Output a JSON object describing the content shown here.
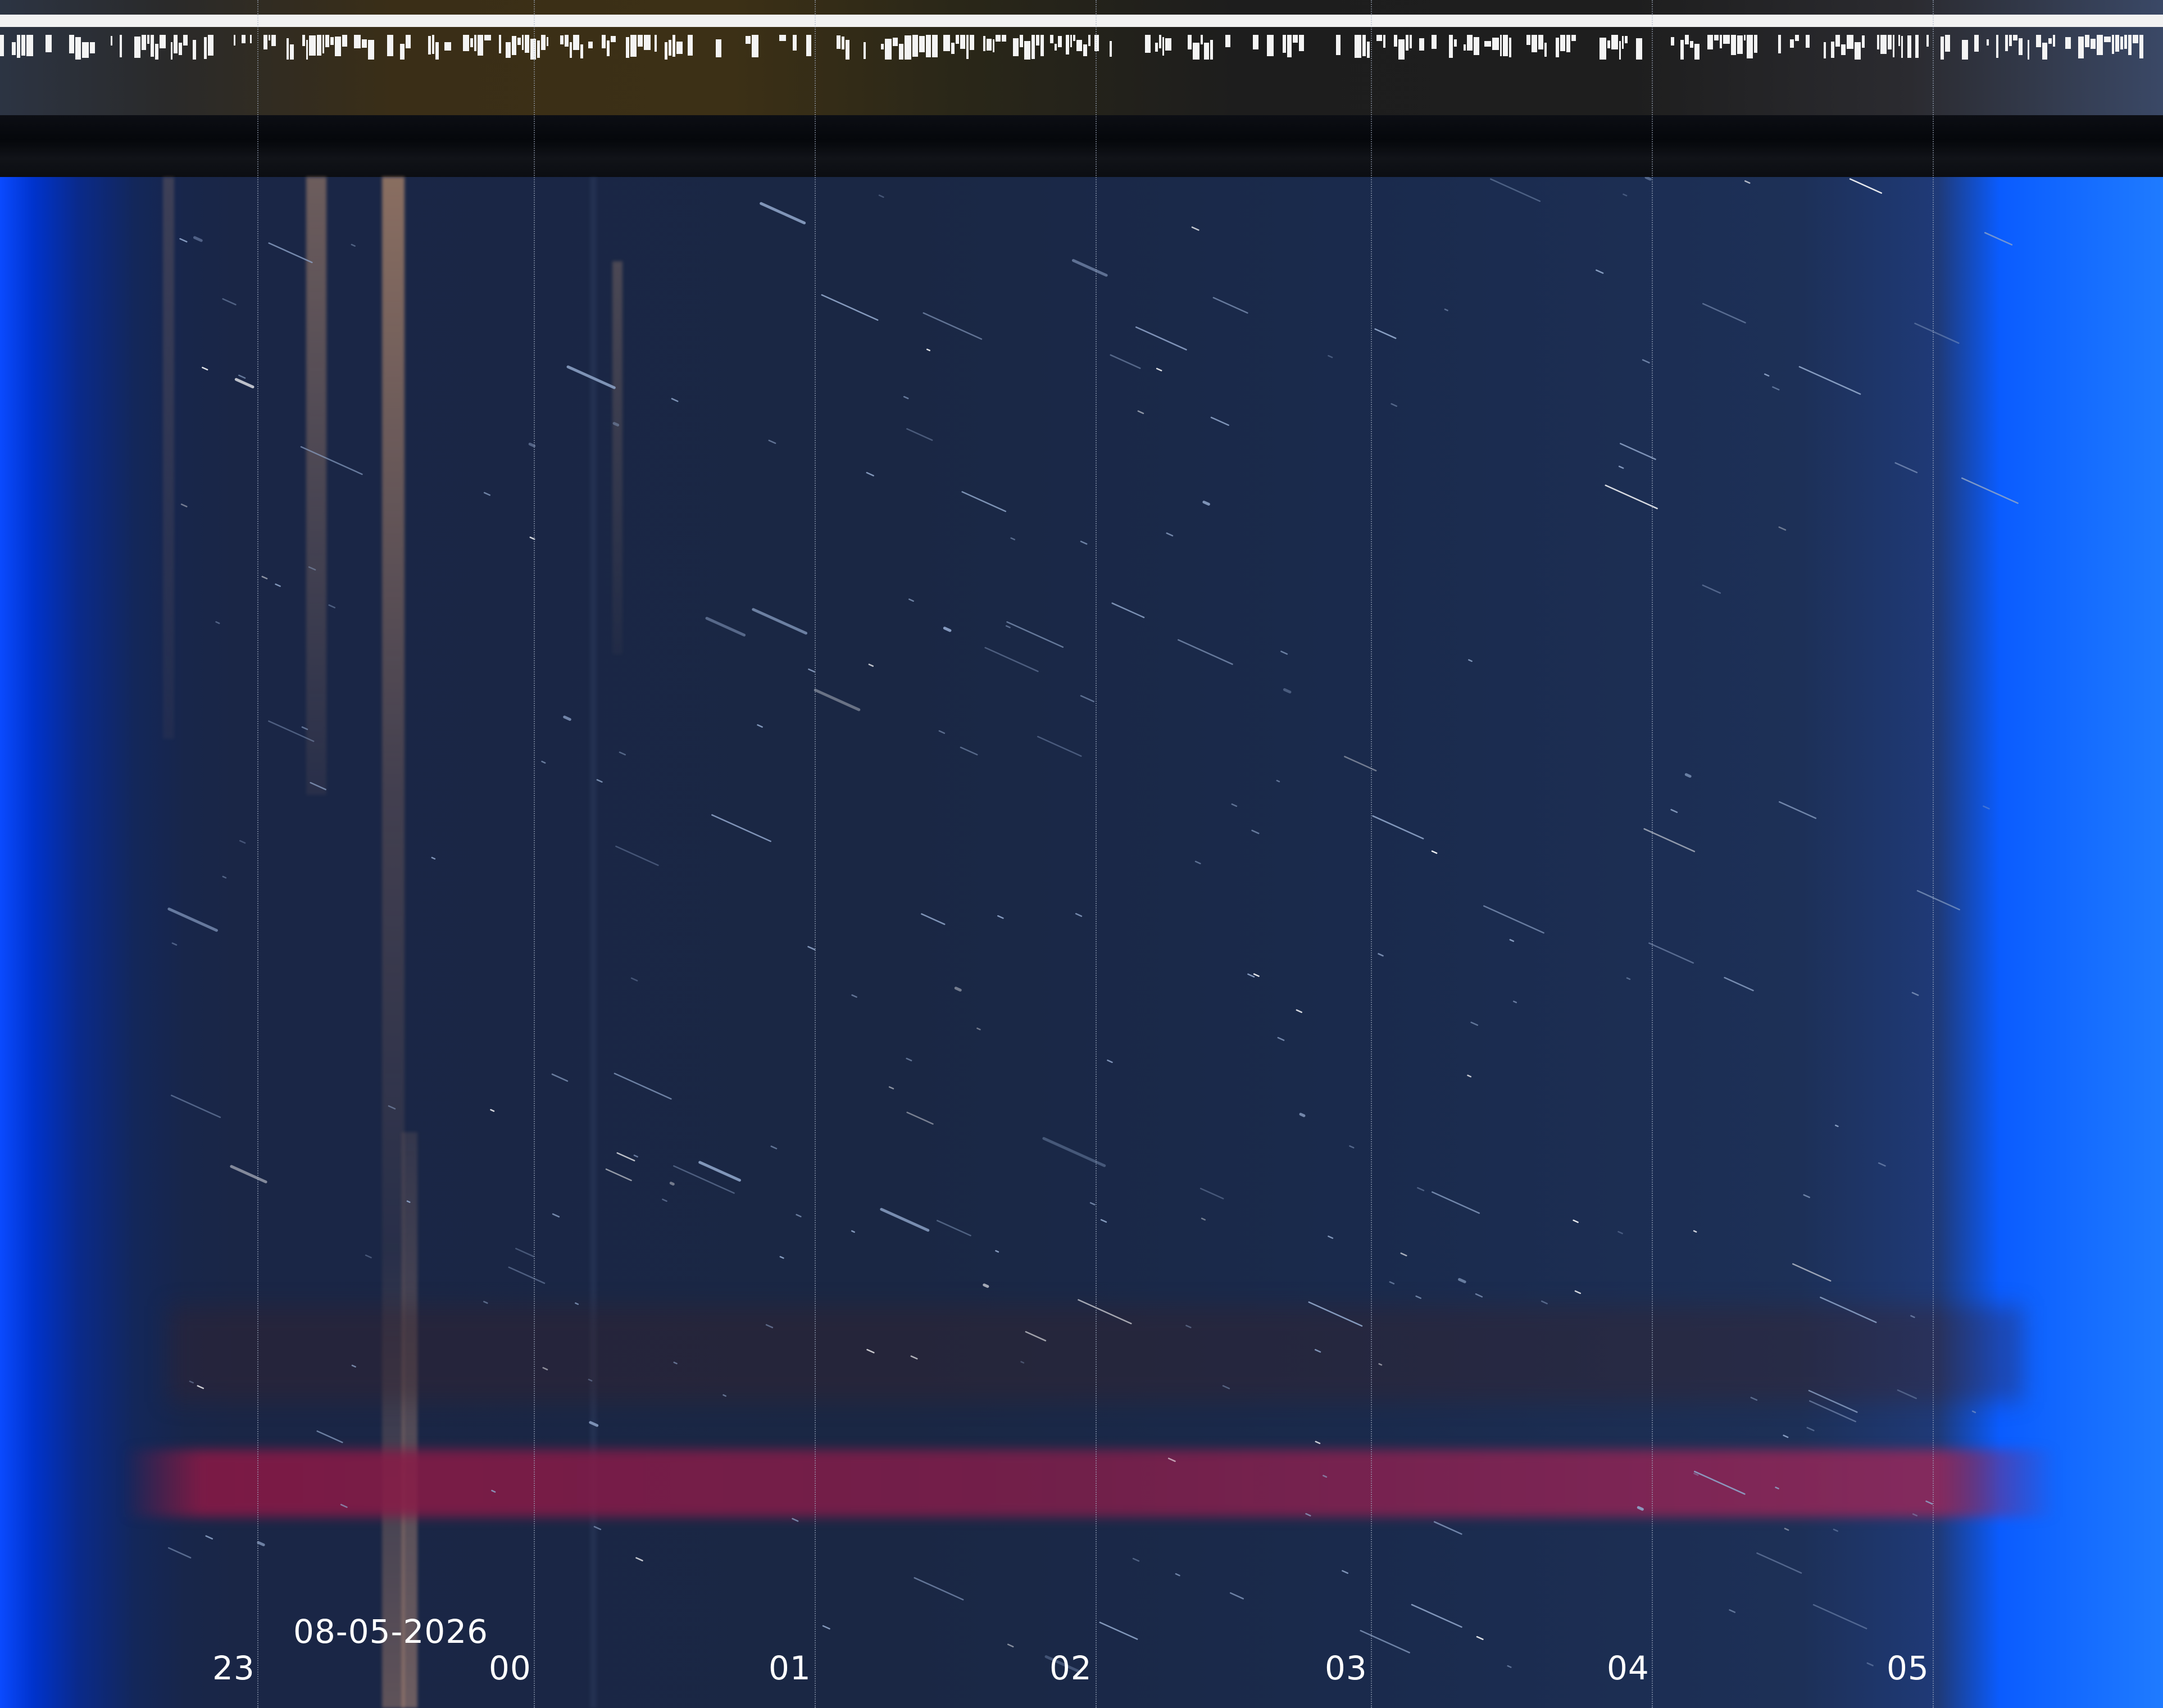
{
  "date": "08-05-2026",
  "hour_labels": [
    "23",
    "00",
    "01",
    "02",
    "03",
    "04",
    "05"
  ],
  "colors": {
    "sky": "#1a2744",
    "edge_blue": "#0a4aff",
    "red_band": "#8c1946",
    "label": "#ffffff"
  }
}
